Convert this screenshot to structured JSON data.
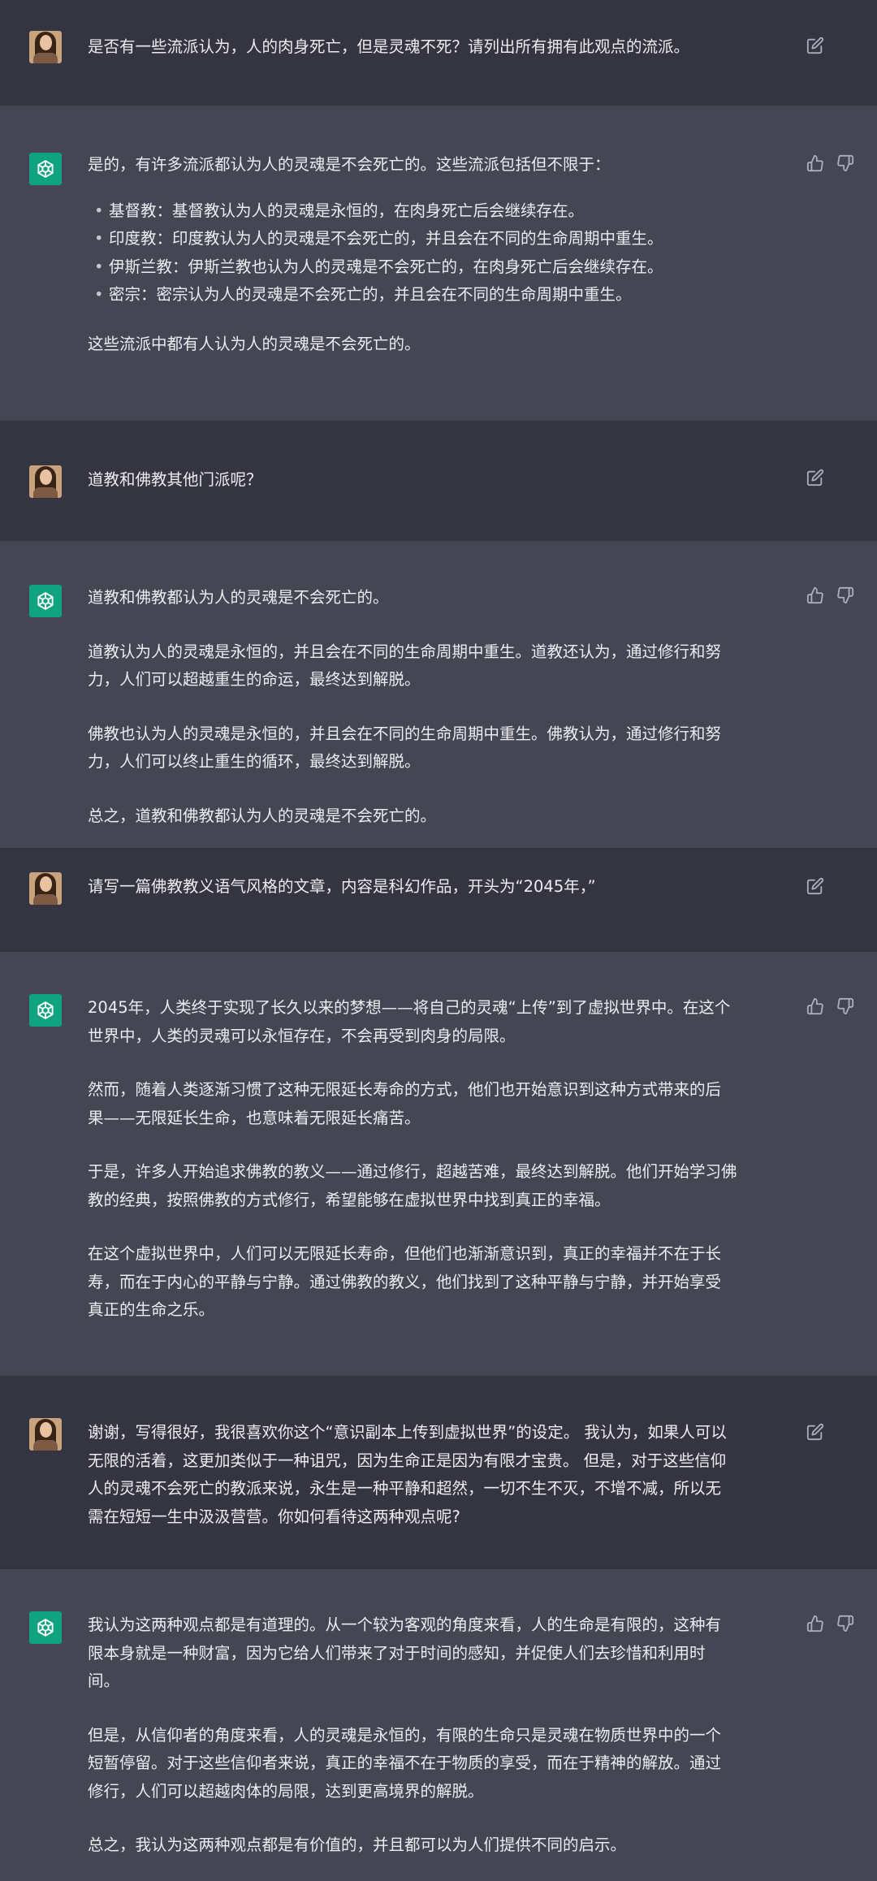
{
  "conversation": {
    "q1": "是否有一些流派认为，人的肉身死亡，但是灵魂不死？请列出所有拥有此观点的流派。",
    "a1": {
      "intro": "是的，有许多流派都认为人的灵魂是不会死亡的。这些流派包括但不限于：",
      "items": [
        "基督教：基督教认为人的灵魂是永恒的，在肉身死亡后会继续存在。",
        "印度教：印度教认为人的灵魂是不会死亡的，并且会在不同的生命周期中重生。",
        "伊斯兰教：伊斯兰教也认为人的灵魂是不会死亡的，在肉身死亡后会继续存在。",
        "密宗：密宗认为人的灵魂是不会死亡的，并且会在不同的生命周期中重生。"
      ],
      "outro": "这些流派中都有人认为人的灵魂是不会死亡的。"
    },
    "q2": "道教和佛教其他门派呢？",
    "a2": {
      "p1": "道教和佛教都认为人的灵魂是不会死亡的。",
      "p2_l1": "道教认为人的灵魂是永恒的，并且会在不同的生命周期中重生。道教还认为，通过修行和努",
      "p2_l2": "力，人们可以超越重生的命运，最终达到解脱。",
      "p3_l1": "佛教也认为人的灵魂是永恒的，并且会在不同的生命周期中重生。佛教认为，通过修行和努",
      "p3_l2": "力，人们可以终止重生的循环，最终达到解脱。",
      "p4": "总之，道教和佛教都认为人的灵魂是不会死亡的。"
    },
    "q3": "请写一篇佛教教义语气风格的文章，内容是科幻作品，开头为“2045年，”",
    "a3": {
      "p1_l1": "2045年，人类终于实现了长久以来的梦想——将自己的灵魂“上传”到了虚拟世界中。在这个",
      "p1_l2": "世界中，人类的灵魂可以永恒存在，不会再受到肉身的局限。",
      "p2_l1": "然而，随着人类逐渐习惯了这种无限延长寿命的方式，他们也开始意识到这种方式带来的后",
      "p2_l2": "果——无限延长生命，也意味着无限延长痛苦。",
      "p3_l1": "于是，许多人开始追求佛教的教义——通过修行，超越苦难，最终达到解脱。他们开始学习佛",
      "p3_l2": "教的经典，按照佛教的方式修行，希望能够在虚拟世界中找到真正的幸福。",
      "p4_l1": "在这个虚拟世界中，人们可以无限延长寿命，但他们也渐渐意识到，真正的幸福并不在于长",
      "p4_l2": "寿，而在于内心的平静与宁静。通过佛教的教义，他们找到了这种平静与宁静，并开始享受",
      "p4_l3": "真正的生命之乐。"
    },
    "q4": {
      "l1": "谢谢，写得很好，我很喜欢你这个“意识副本上传到虚拟世界”的设定。 我认为，如果人可以",
      "l2": "无限的活着，这更加类似于一种诅咒，因为生命正是因为有限才宝贵。 但是，对于这些信仰",
      "l3": "人的灵魂不会死亡的教派来说，永生是一种平静和超然，一切不生不灭，不增不减，所以无",
      "l4": "需在短短一生中汲汲营营。你如何看待这两种观点呢?"
    },
    "a4": {
      "p1_l1": "我认为这两种观点都是有道理的。从一个较为客观的角度来看，人的生命是有限的，这种有",
      "p1_l2": "限本身就是一种财富，因为它给人们带来了对于时间的感知，并促使人们去珍惜和利用时",
      "p1_l3": "间。",
      "p2_l1": "但是，从信仰者的角度来看，人的灵魂是永恒的，有限的生命只是灵魂在物质世界中的一个",
      "p2_l2": "短暂停留。对于这些信仰者来说，真正的幸福不在于物质的享受，而在于精神的解放。通过",
      "p2_l3": "修行，人们可以超越肉体的局限，达到更高境界的解脱。",
      "p3": "总之，我认为这两种观点都是有价值的，并且都可以为人们提供不同的启示。"
    }
  },
  "colors": {
    "user_bg": "#343541",
    "bot_bg": "#444654",
    "bot_avatar": "#10a37f",
    "text": "#ececf1",
    "icon": "#acacbe"
  },
  "icons": [
    "edit-icon",
    "thumbs-up-icon",
    "thumbs-down-icon",
    "openai-logo-icon"
  ]
}
